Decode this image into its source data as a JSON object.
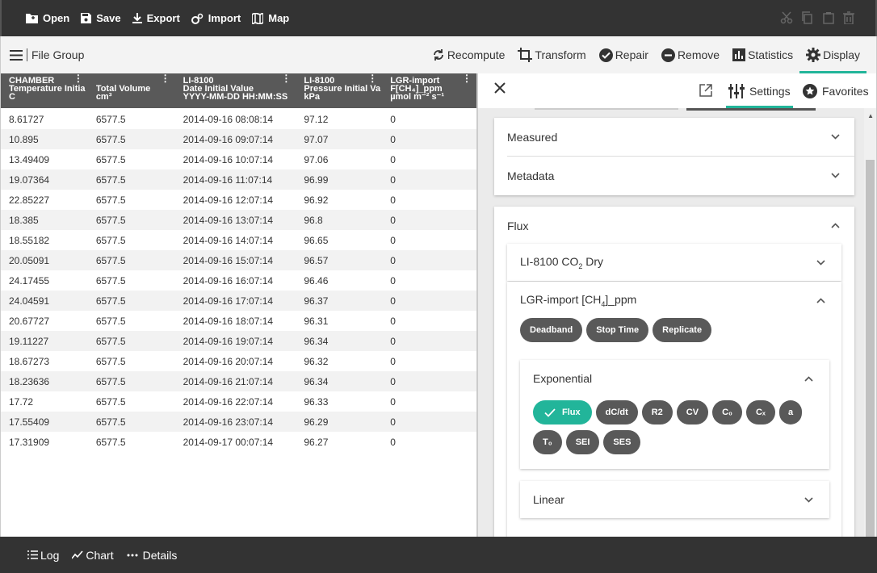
{
  "topbar": {
    "open": "Open",
    "save": "Save",
    "export": "Export",
    "import": "Import",
    "map": "Map"
  },
  "toolbar": {
    "file_group": "File Group",
    "recompute": "Recompute",
    "transform": "Transform",
    "repair": "Repair",
    "remove": "Remove",
    "statistics": "Statistics",
    "display": "Display"
  },
  "grid": {
    "columns": [
      {
        "l1": "CHAMBER",
        "l2": "Temperature Initia",
        "l3": "C"
      },
      {
        "l1": "",
        "l2": "Total Volume",
        "l3": "cm³"
      },
      {
        "l1": "LI-8100",
        "l2": "Date Initial Value",
        "l3": "YYYY-MM-DD HH:MM:SS"
      },
      {
        "l1": "LI-8100",
        "l2": "Pressure Initial Va",
        "l3": "kPa"
      },
      {
        "l1": "LGR-import",
        "l2": "F[CH₄]_ppm",
        "l3": "µmol m⁻² s⁻¹"
      }
    ],
    "rows": [
      [
        "8.61727",
        "6577.5",
        "2014-09-16 08:08:14",
        "97.12",
        "0"
      ],
      [
        "10.895",
        "6577.5",
        "2014-09-16 09:07:14",
        "97.07",
        "0"
      ],
      [
        "13.49409",
        "6577.5",
        "2014-09-16 10:07:14",
        "97.06",
        "0"
      ],
      [
        "19.07364",
        "6577.5",
        "2014-09-16 11:07:14",
        "96.99",
        "0"
      ],
      [
        "22.85227",
        "6577.5",
        "2014-09-16 12:07:14",
        "96.92",
        "0"
      ],
      [
        "18.385",
        "6577.5",
        "2014-09-16 13:07:14",
        "96.8",
        "0"
      ],
      [
        "18.55182",
        "6577.5",
        "2014-09-16 14:07:14",
        "96.65",
        "0"
      ],
      [
        "20.05091",
        "6577.5",
        "2014-09-16 15:07:14",
        "96.57",
        "0"
      ],
      [
        "24.17455",
        "6577.5",
        "2014-09-16 16:07:14",
        "96.46",
        "0"
      ],
      [
        "24.04591",
        "6577.5",
        "2014-09-16 17:07:14",
        "96.37",
        "0"
      ],
      [
        "20.67727",
        "6577.5",
        "2014-09-16 18:07:14",
        "96.31",
        "0"
      ],
      [
        "19.11227",
        "6577.5",
        "2014-09-16 19:07:14",
        "96.34",
        "0"
      ],
      [
        "18.67273",
        "6577.5",
        "2014-09-16 20:07:14",
        "96.32",
        "0"
      ],
      [
        "18.23636",
        "6577.5",
        "2014-09-16 21:07:14",
        "96.34",
        "0"
      ],
      [
        "17.72",
        "6577.5",
        "2014-09-16 22:07:14",
        "96.33",
        "0"
      ],
      [
        "17.55409",
        "6577.5",
        "2014-09-16 23:07:14",
        "96.29",
        "0"
      ],
      [
        "17.31909",
        "6577.5",
        "2014-09-17 00:07:14",
        "96.27",
        "0"
      ]
    ]
  },
  "panel": {
    "settings": "Settings",
    "favorites": "Favorites",
    "measured": "Measured",
    "metadata": "Metadata",
    "flux": "Flux",
    "li8100_prefix": "LI-8100 CO",
    "li8100_sub": "2",
    "li8100_suffix": " Dry",
    "lgr_prefix": "LGR-import [CH",
    "lgr_sub": "4",
    "lgr_suffix": "]_ppm",
    "buttons": [
      "Deadband",
      "Stop Time",
      "Replicate"
    ],
    "exponential": "Exponential",
    "exp_pills_row1": [
      "Flux",
      "dC/dt",
      "R2",
      "CV",
      "C₀",
      "Cₓ",
      "a"
    ],
    "exp_pills_row2": [
      "T₀",
      "SEI",
      "SES"
    ],
    "linear": "Linear"
  },
  "bottombar": {
    "log": "Log",
    "chart": "Chart",
    "details": "Details"
  },
  "colors": {
    "accent": "#22b59a",
    "bar": "#333333",
    "header": "#595959"
  }
}
